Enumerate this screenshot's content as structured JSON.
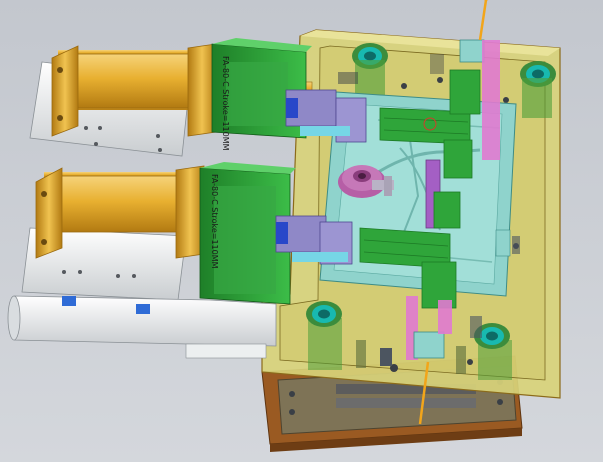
{
  "viewport": {
    "background_top": "#c3c7ce",
    "background_bottom": "#d4d7dc"
  },
  "cylinders": [
    {
      "id": "upper",
      "stroke_label": "FA-80-C Stroke=110MM"
    },
    {
      "id": "lower",
      "stroke_label": "FA-80-C Stroke=110MM"
    }
  ],
  "colors": {
    "cylinder_body": "#e8b030",
    "cylinder_dark": "#b27a12",
    "cylinder_highlight": "#f6d37a",
    "plate_yellow": "#e3d96a",
    "plate_translucent": "#d8d27a",
    "plate_edge": "#8b6a1a",
    "bottom_plate": "#9a5a22",
    "cavity_cyan": "#8fd3cc",
    "slider_green": "#2fa53a",
    "slider_green_dark": "#1c7a25",
    "slide_purple": "#8f88c7",
    "pink": "#e07ad0",
    "hot_nozzle": "#c678b8",
    "teal_bushing": "#18b9b0",
    "bracket_white": "#eceff0",
    "blue_seal": "#2947c9",
    "bolt_dark": "#3a3f46",
    "wire_orange": "#f2a51a"
  }
}
